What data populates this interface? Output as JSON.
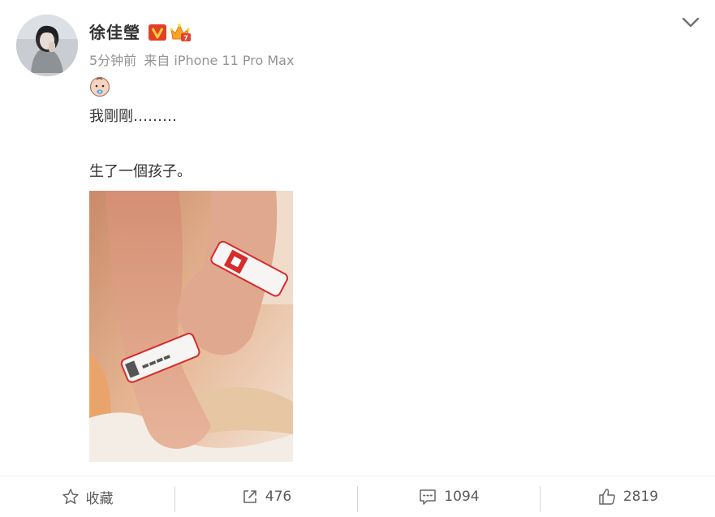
{
  "post": {
    "author": {
      "name": "徐佳瑩",
      "verified_badge_icon": "verified-v-badge-icon",
      "vip_badge_icon": "vip-crown-badge-icon"
    },
    "time": "5分钟前",
    "source": "来自 iPhone 11 Pro Max",
    "emoji_icon": "baby-emoji-icon",
    "text_line1": "我剛剛………",
    "text_line2": "生了一個孩子。",
    "photo_icon": "newborn-feet-photo"
  },
  "actions": {
    "favorite_label": "收藏",
    "share_count": "476",
    "comment_count": "1094",
    "like_count": "2819"
  },
  "colors": {
    "text": "#333333",
    "meta": "#939393",
    "verified": "#e14123",
    "vip": "#f6a623"
  }
}
